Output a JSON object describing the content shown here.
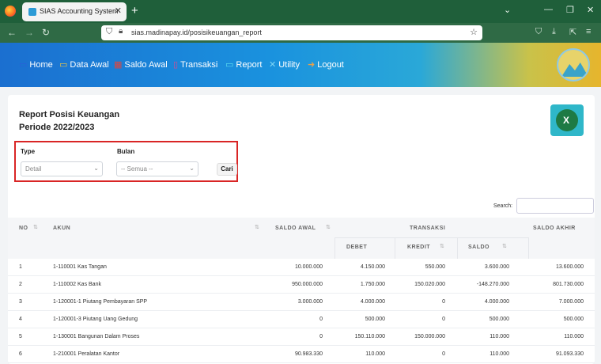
{
  "browser": {
    "tab_title": "SIAS Accounting System",
    "url": "sias.madinapay.id/posisikeuangan_report"
  },
  "menu": [
    {
      "label": "Home",
      "icon": "home-icon",
      "color": "#2b5fd9"
    },
    {
      "label": "Data Awal",
      "icon": "monitor-icon",
      "color": "#f2c744"
    },
    {
      "label": "Saldo Awal",
      "icon": "calendar-icon",
      "color": "#e0463d"
    },
    {
      "label": "Transaksi",
      "icon": "file-icon",
      "color": "#d64a8f"
    },
    {
      "label": "Report",
      "icon": "report-icon",
      "color": "#5ee0f0"
    },
    {
      "label": "Utility",
      "icon": "wrench-icon",
      "color": "#7fd6f5"
    },
    {
      "label": "Logout",
      "icon": "logout-icon",
      "color": "#e8a04a"
    }
  ],
  "report": {
    "title": "Report Posisi Keuangan",
    "period": "Periode 2022/2023"
  },
  "filter": {
    "type_label": "Type",
    "type_value": "Detail",
    "month_label": "Bulan",
    "month_value": "-- Semua --",
    "search_button": "Cari"
  },
  "table": {
    "search_label": "Search:",
    "headers": {
      "no": "NO",
      "akun": "AKUN",
      "saldo_awal": "SALDO AWAL",
      "transaksi": "TRANSAKSI",
      "debet": "DEBET",
      "kredit": "KREDIT",
      "saldo": "SALDO",
      "saldo_akhir": "SALDO AKHIR"
    },
    "rows": [
      {
        "no": "1",
        "akun": "1-110001 Kas Tangan",
        "saldo_awal": "10.000.000",
        "debet": "4.150.000",
        "kredit": "550.000",
        "saldo": "3.600.000",
        "saldo_akhir": "13.600.000"
      },
      {
        "no": "2",
        "akun": "1-110002 Kas Bank",
        "saldo_awal": "950.000.000",
        "debet": "1.750.000",
        "kredit": "150.020.000",
        "saldo": "-148.270.000",
        "saldo_akhir": "801.730.000"
      },
      {
        "no": "3",
        "akun": "1-120001-1 Piutang Pembayaran SPP",
        "saldo_awal": "3.000.000",
        "debet": "4.000.000",
        "kredit": "0",
        "saldo": "4.000.000",
        "saldo_akhir": "7.000.000"
      },
      {
        "no": "4",
        "akun": "1-120001-3 Piutang Uang Gedung",
        "saldo_awal": "0",
        "debet": "500.000",
        "kredit": "0",
        "saldo": "500.000",
        "saldo_akhir": "500.000"
      },
      {
        "no": "5",
        "akun": "1-130001 Bangunan Dalam Proses",
        "saldo_awal": "0",
        "debet": "150.110.000",
        "kredit": "150.000.000",
        "saldo": "110.000",
        "saldo_akhir": "110.000"
      },
      {
        "no": "6",
        "akun": "1-210001 Peralatan Kantor",
        "saldo_awal": "90.983.330",
        "debet": "110.000",
        "kredit": "0",
        "saldo": "110.000",
        "saldo_akhir": "91.093.330"
      }
    ]
  }
}
